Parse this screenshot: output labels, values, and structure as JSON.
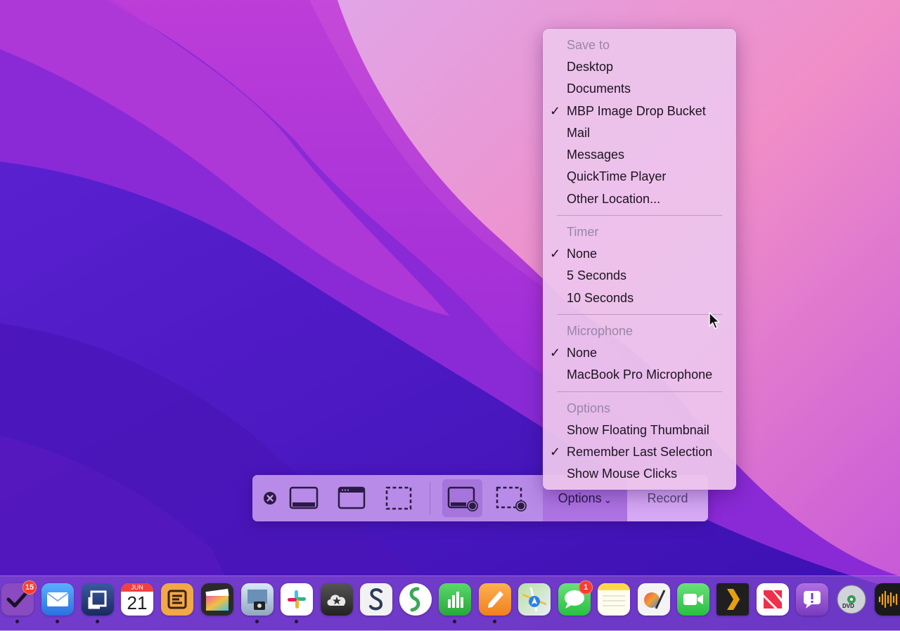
{
  "toolbar": {
    "options_label": "Options",
    "record_label": "Record",
    "buttons": [
      {
        "name": "close-icon"
      },
      {
        "name": "capture-entire-screen-icon"
      },
      {
        "name": "capture-selected-window-icon"
      },
      {
        "name": "capture-selected-portion-icon"
      },
      {
        "name": "record-entire-screen-icon"
      },
      {
        "name": "record-selected-portion-icon"
      }
    ]
  },
  "menu": {
    "sections": [
      {
        "header": "Save to",
        "items": [
          {
            "label": "Desktop",
            "checked": false
          },
          {
            "label": "Documents",
            "checked": false
          },
          {
            "label": "MBP Image Drop Bucket",
            "checked": true
          },
          {
            "label": "Mail",
            "checked": false
          },
          {
            "label": "Messages",
            "checked": false
          },
          {
            "label": "QuickTime Player",
            "checked": false
          },
          {
            "label": "Other Location...",
            "checked": false
          }
        ]
      },
      {
        "header": "Timer",
        "items": [
          {
            "label": "None",
            "checked": true
          },
          {
            "label": "5 Seconds",
            "checked": false
          },
          {
            "label": "10 Seconds",
            "checked": false
          }
        ]
      },
      {
        "header": "Microphone",
        "items": [
          {
            "label": "None",
            "checked": true
          },
          {
            "label": "MacBook Pro Microphone",
            "checked": false
          }
        ]
      },
      {
        "header": "Options",
        "items": [
          {
            "label": "Show Floating Thumbnail",
            "checked": false
          },
          {
            "label": "Remember Last Selection",
            "checked": true
          },
          {
            "label": "Show Mouse Clicks",
            "checked": false
          }
        ]
      }
    ],
    "check_glyph": "✓"
  },
  "dock": {
    "calendar_month": "JUN",
    "calendar_day": "21",
    "badges": {
      "omnifocus": "15",
      "messages": "1"
    },
    "dvd_label": "DVD",
    "apps": [
      {
        "name": "omnifocus-icon",
        "color": "#7a3fb0"
      },
      {
        "name": "mail-icon",
        "color": "#3a8ef0"
      },
      {
        "name": "screens-icon",
        "color": "#2a4a8a"
      },
      {
        "name": "calendar-icon",
        "color": "#ffffff"
      },
      {
        "name": "taskheat-icon",
        "color": "#f0a040"
      },
      {
        "name": "final-cut-pro-icon",
        "color": "#2a2a2a"
      },
      {
        "name": "preview-icon",
        "color": "#c8d8e8"
      },
      {
        "name": "slack-icon",
        "color": "#ffffff"
      },
      {
        "name": "cloud-star-icon",
        "color": "#3a3a3a"
      },
      {
        "name": "scrivener-icon",
        "color": "#f4f4f4"
      },
      {
        "name": "snail-app-icon",
        "color": "#ffffff"
      },
      {
        "name": "numbers-icon",
        "color": "#3ac04a"
      },
      {
        "name": "pages-icon",
        "color": "#f09a30"
      },
      {
        "name": "maps-icon",
        "color": "#e8f0e0"
      },
      {
        "name": "messages-icon",
        "color": "#3ad05a"
      },
      {
        "name": "notes-icon",
        "color": "#fff6c8"
      },
      {
        "name": "pixelmator-icon",
        "color": "#f0f0f0"
      },
      {
        "name": "facetime-icon",
        "color": "#3ad05a"
      },
      {
        "name": "plex-icon",
        "color": "#222222"
      },
      {
        "name": "news-icon",
        "color": "#ffffff"
      },
      {
        "name": "feedback-assistant-icon",
        "color": "#9a5ad0"
      },
      {
        "name": "dvd-player-icon",
        "color": "#d8d8d8"
      },
      {
        "name": "voice-memos-icon",
        "color": "#1a1a1a"
      }
    ]
  }
}
